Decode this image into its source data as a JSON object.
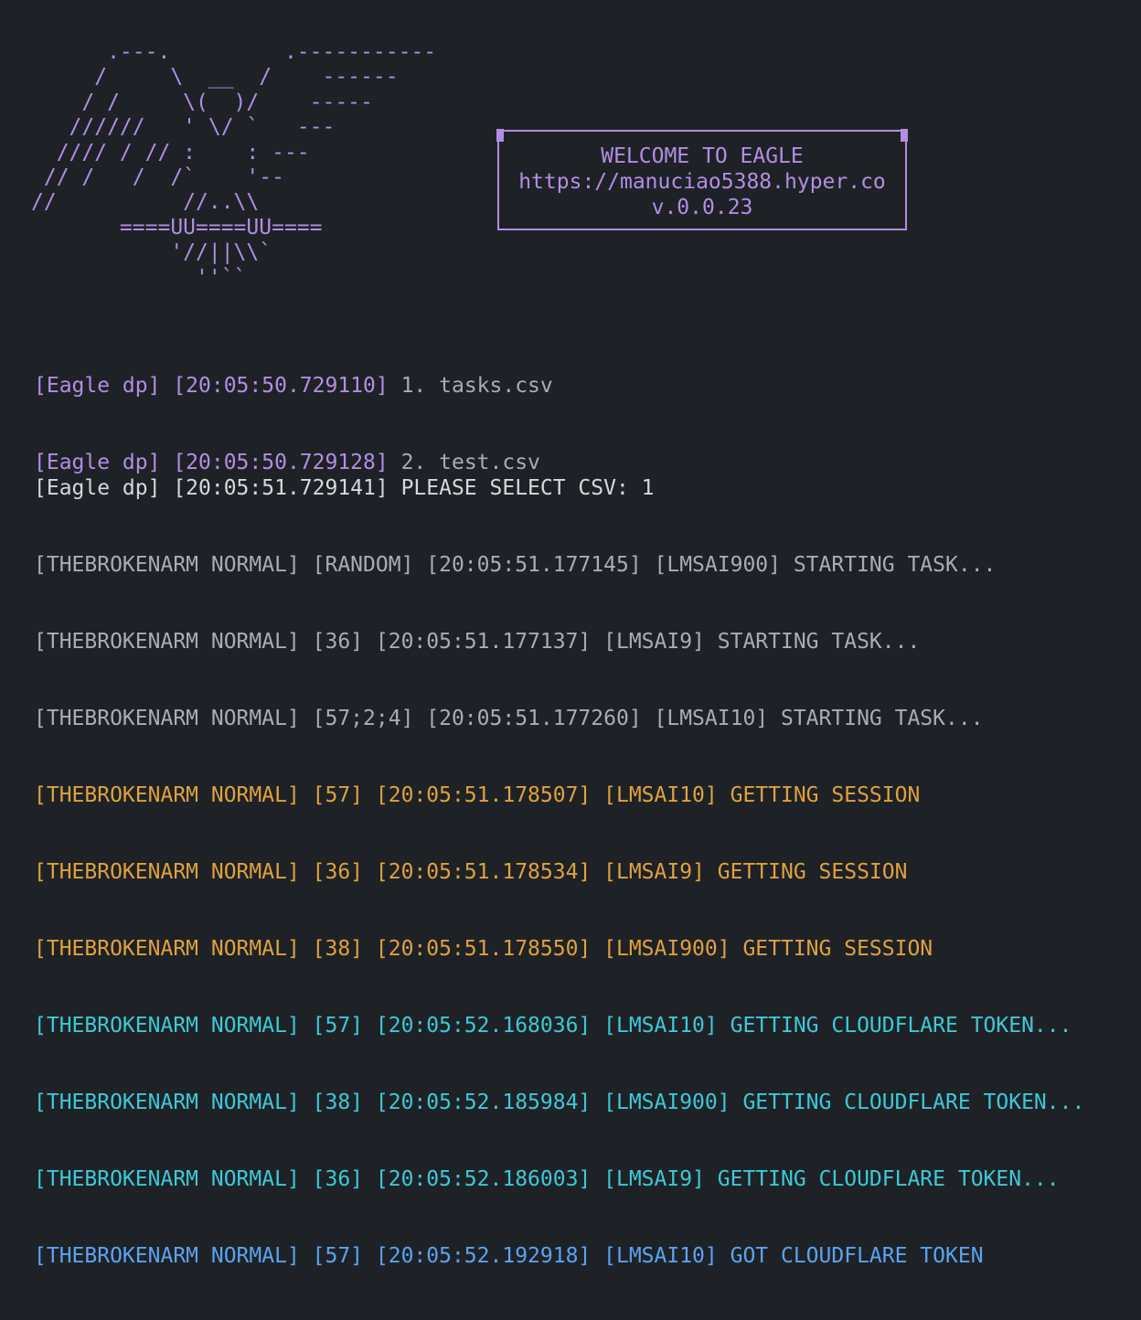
{
  "banner": {
    "ascii_art": "      .---.         .-----------\n     /     \\  __  /    ------\n    / /     \\(  )/    -----\n   //////   ' \\/ `   ---\n  //// / // :    : ---\n // /   /  /`    '--\n//          //..\\\\\n       ====UU====UU====\n           '//||\\\\`\n             ''``",
    "welcome_title": "WELCOME TO EAGLE",
    "url": "https://manuciao5388.hyper.co",
    "version": "v.0.0.23"
  },
  "csv_list": [
    {
      "prefix": "[Eagle dp] [20:05:50.729110]",
      "text": " 1. tasks.csv"
    },
    {
      "prefix": "[Eagle dp] [20:05:50.729128]",
      "text": " 2. test.csv"
    }
  ],
  "prompt": {
    "text": "[Eagle dp] [20:05:51.729141] PLEASE SELECT CSV: 1"
  },
  "log_lines": [
    {
      "color": "gray",
      "text": "[THEBROKENARM NORMAL] [RANDOM] [20:05:51.177145] [LMSAI900] STARTING TASK..."
    },
    {
      "color": "gray",
      "text": "[THEBROKENARM NORMAL] [36] [20:05:51.177137] [LMSAI9] STARTING TASK..."
    },
    {
      "color": "gray",
      "text": "[THEBROKENARM NORMAL] [57;2;4] [20:05:51.177260] [LMSAI10] STARTING TASK..."
    },
    {
      "color": "orange",
      "text": "[THEBROKENARM NORMAL] [57] [20:05:51.178507] [LMSAI10] GETTING SESSION"
    },
    {
      "color": "orange",
      "text": "[THEBROKENARM NORMAL] [36] [20:05:51.178534] [LMSAI9] GETTING SESSION"
    },
    {
      "color": "orange",
      "text": "[THEBROKENARM NORMAL] [38] [20:05:51.178550] [LMSAI900] GETTING SESSION"
    },
    {
      "color": "cyan",
      "text": "[THEBROKENARM NORMAL] [57] [20:05:52.168036] [LMSAI10] GETTING CLOUDFLARE TOKEN..."
    },
    {
      "color": "cyan",
      "text": "[THEBROKENARM NORMAL] [38] [20:05:52.185984] [LMSAI900] GETTING CLOUDFLARE TOKEN..."
    },
    {
      "color": "cyan",
      "text": "[THEBROKENARM NORMAL] [36] [20:05:52.186003] [LMSAI9] GETTING CLOUDFLARE TOKEN..."
    },
    {
      "color": "blue",
      "text": "[THEBROKENARM NORMAL] [57] [20:05:52.192918] [LMSAI10] GOT CLOUDFLARE TOKEN"
    }
  ],
  "colors": {
    "background": "#1e2227",
    "purple": "#b38de2",
    "gray": "#a9adb3",
    "white": "#d5d8dc",
    "orange": "#e0a13c",
    "cyan": "#3cc9d6",
    "blue": "#5ba3f0"
  }
}
